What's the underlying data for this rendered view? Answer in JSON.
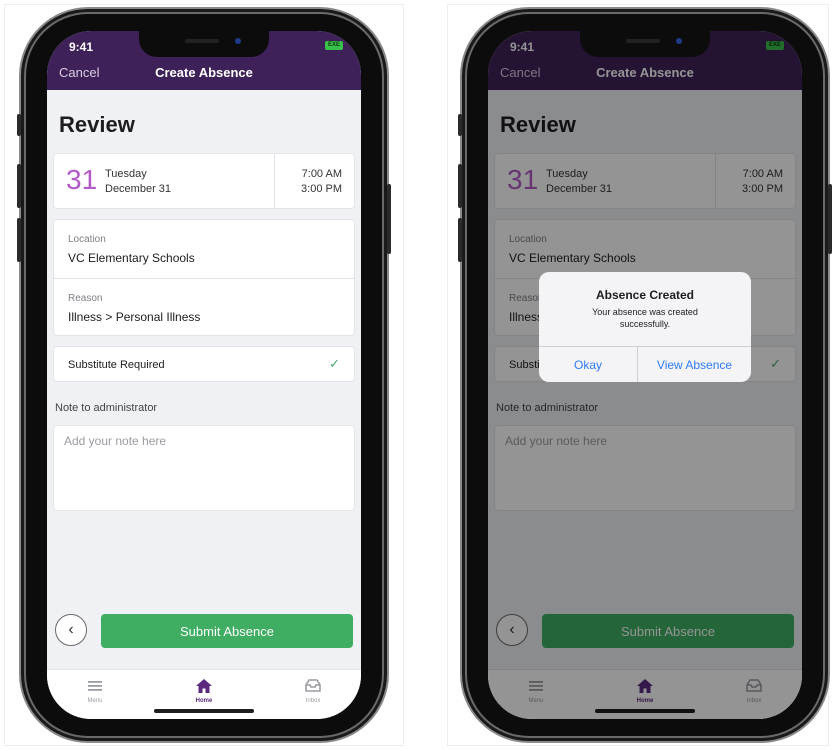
{
  "status_time": "9:41",
  "battery_label": "EXE",
  "nav": {
    "cancel": "Cancel",
    "title": "Create Absence"
  },
  "review_title": "Review",
  "date_card": {
    "day_number": "31",
    "day_name": "Tuesday",
    "date": "December 31",
    "start_time": "7:00 AM",
    "end_time": "3:00 PM"
  },
  "location": {
    "label": "Location",
    "value": "VC Elementary Schools"
  },
  "reason": {
    "label": "Reason",
    "value": "Illness > Personal Illness"
  },
  "substitute": {
    "label": "Substitute Required",
    "checked": true
  },
  "note": {
    "label": "Note to administrator",
    "placeholder": "Add your note here"
  },
  "submit_label": "Submit Absence",
  "tabs": [
    {
      "label": "Menu",
      "icon": "menu-icon"
    },
    {
      "label": "Home",
      "icon": "home-icon",
      "active": true
    },
    {
      "label": "Inbox",
      "icon": "inbox-icon"
    }
  ],
  "alert": {
    "title": "Absence Created",
    "message": "Your absence was created successfully.",
    "okay": "Okay",
    "view": "View Absence"
  },
  "colors": {
    "header": "#3e2158",
    "accent_green": "#3fae63",
    "day_number": "#b35ac9",
    "link_blue": "#2f7bf5"
  }
}
